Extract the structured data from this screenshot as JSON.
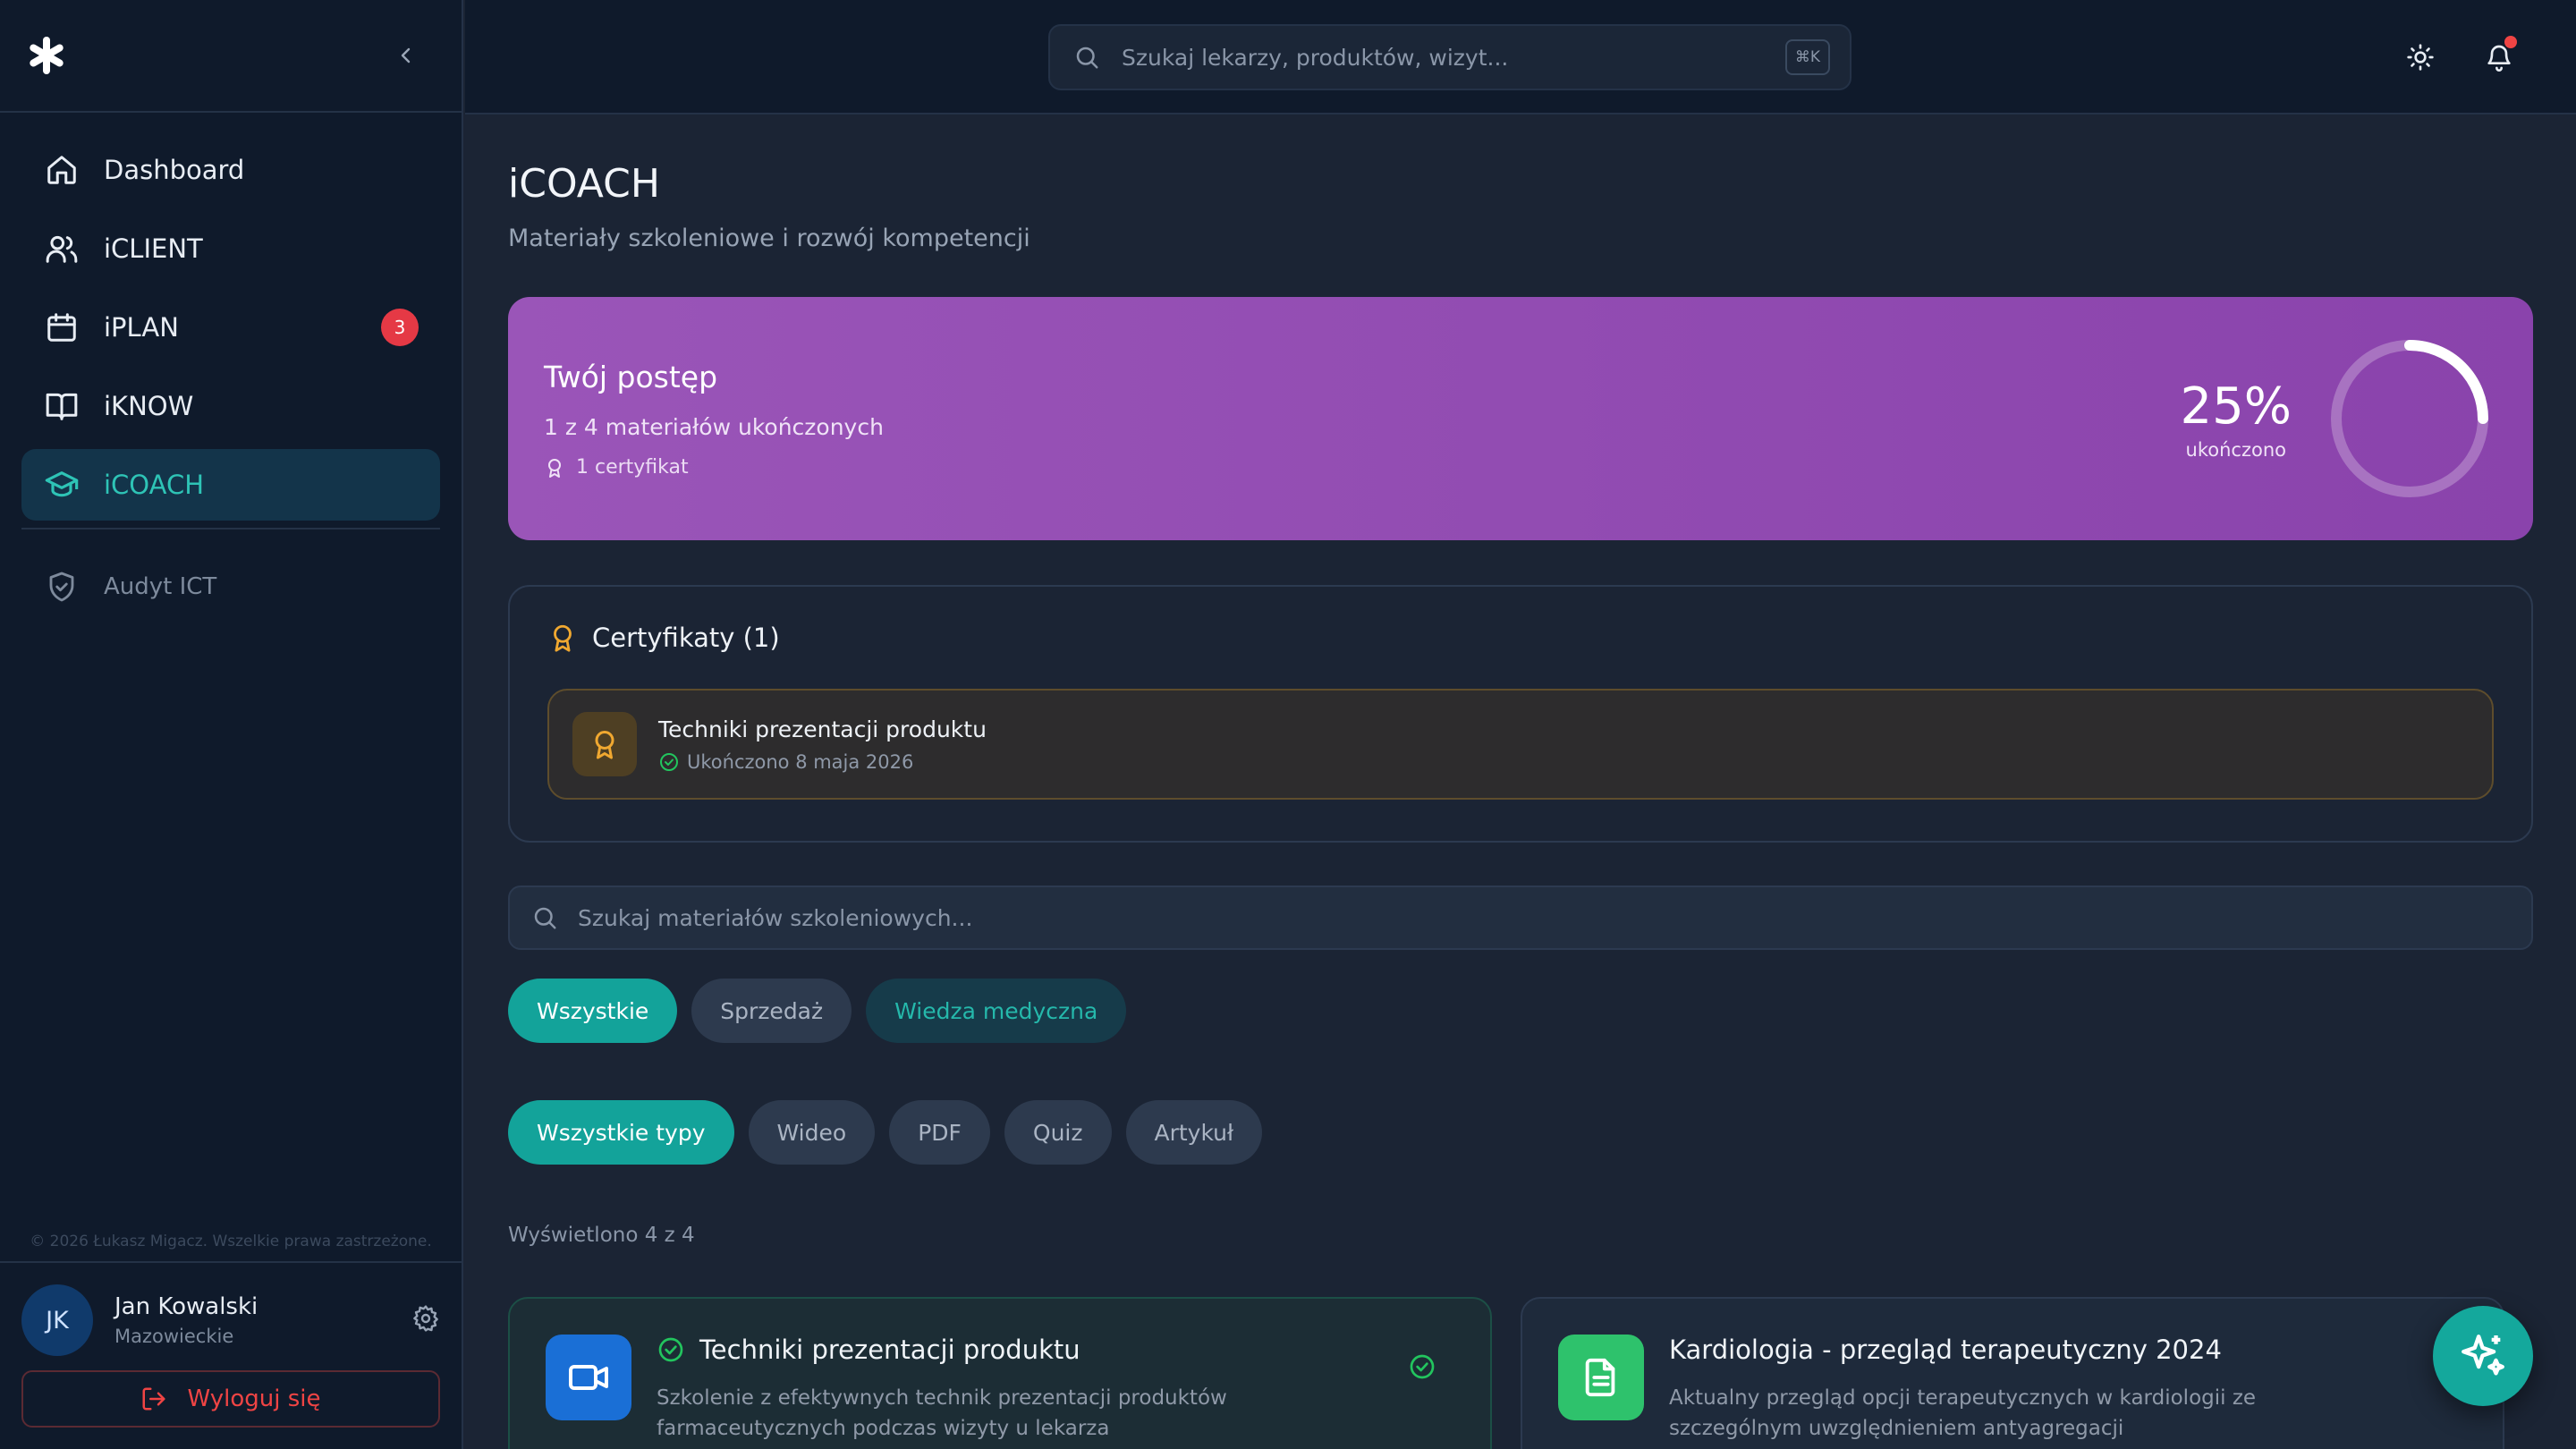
{
  "sidebar": {
    "nav": [
      {
        "label": "Dashboard",
        "icon": "home-icon"
      },
      {
        "label": "iCLIENT",
        "icon": "users-icon"
      },
      {
        "label": "iPLAN",
        "icon": "calendar-icon",
        "badge": "3"
      },
      {
        "label": "iKNOW",
        "icon": "book-icon"
      },
      {
        "label": "iCOACH",
        "icon": "graduation-cap-icon",
        "active": true
      }
    ],
    "secondary": {
      "label": "Audyt ICT",
      "icon": "shield-check-icon"
    },
    "copyright": "© 2026 Łukasz Migacz. Wszelkie prawa zastrzeżone.",
    "user": {
      "initials": "JK",
      "name": "Jan Kowalski",
      "region": "Mazowieckie"
    },
    "logout_label": "Wyloguj się"
  },
  "topbar": {
    "search_placeholder": "Szukaj lekarzy, produktów, wizyt...",
    "shortcut": "⌘K"
  },
  "page": {
    "title": "iCOACH",
    "subtitle": "Materiały szkoleniowe i rozwój kompetencji"
  },
  "progress": {
    "title": "Twój postęp",
    "summary": "1 z 4 materiałów ukończonych",
    "certificates": "1 certyfikat",
    "percent_label": "25%",
    "percent_caption": "ukończono",
    "percent_value": 25
  },
  "certificates": {
    "title": "Certyfikaty (1)",
    "items": [
      {
        "name": "Techniki prezentacji produktu",
        "date": "Ukończono 8 maja 2026"
      }
    ]
  },
  "materials": {
    "search_placeholder": "Szukaj materiałów szkoleniowych...",
    "category_filters": [
      "Wszystkie",
      "Sprzedaż",
      "Wiedza medyczna"
    ],
    "type_filters": [
      "Wszystkie typy",
      "Wideo",
      "PDF",
      "Quiz",
      "Artykuł"
    ],
    "shown_count": "Wyświetlono 4 z 4",
    "cards": [
      {
        "title": "Techniki prezentacji produktu",
        "description": "Szkolenie z efektywnych technik prezentacji produktów farmaceutycznych podczas wizyty u lekarza",
        "type_icon": "video-icon",
        "completed": true
      },
      {
        "title": "Kardiologia - przegląd terapeutyczny 2024",
        "description": "Aktualny przegląd opcji terapeutycznych w kardiologii ze szczególnym uwzględnieniem antyagregacji",
        "type_icon": "document-icon",
        "completed": false
      }
    ]
  },
  "colors": {
    "accent": "#14a89c",
    "progress_gradient": [
      "#9a55b8",
      "#8a43ac"
    ],
    "danger": "#ef4444",
    "certificate_gold": "#f0a830"
  }
}
